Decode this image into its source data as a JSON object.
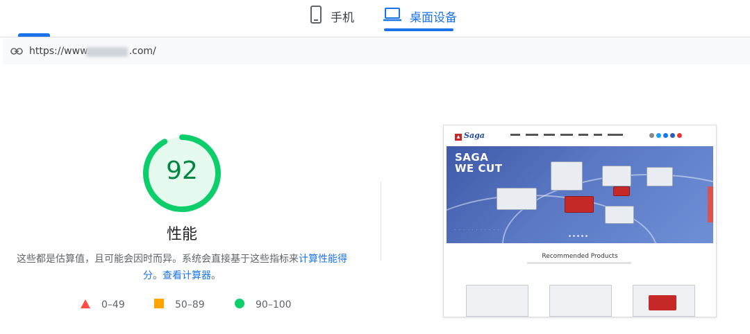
{
  "tabs": {
    "mobile_label": "手机",
    "desktop_label": "桌面设备",
    "active": "desktop"
  },
  "url": {
    "text_start": "https://www.",
    "text_end": ".com/",
    "redacted": true
  },
  "score": {
    "value": "92",
    "fraction": 0.92,
    "color": "#0cce6b",
    "title": "性能"
  },
  "description": {
    "text": "这些都是估算值，且可能会因时而异。系统会直接基于这些指标来",
    "link1": "计算性能得分",
    "separator": "。",
    "link2": "查看计算器",
    "end": "。"
  },
  "legend": [
    {
      "range": "0–49",
      "color": "#ff4e42",
      "shape": "triangle"
    },
    {
      "range": "50–89",
      "color": "#ffa400",
      "shape": "square"
    },
    {
      "range": "90–100",
      "color": "#0cce6b",
      "shape": "circle"
    }
  ],
  "colors": {
    "accent": "#1a73e8",
    "pass": "#0cce6b",
    "average": "#ffa400",
    "fail": "#ff4e42"
  },
  "icons": {
    "mobile_tab": "phone-icon",
    "desktop_tab": "laptop-icon",
    "url": "link-icon"
  }
}
